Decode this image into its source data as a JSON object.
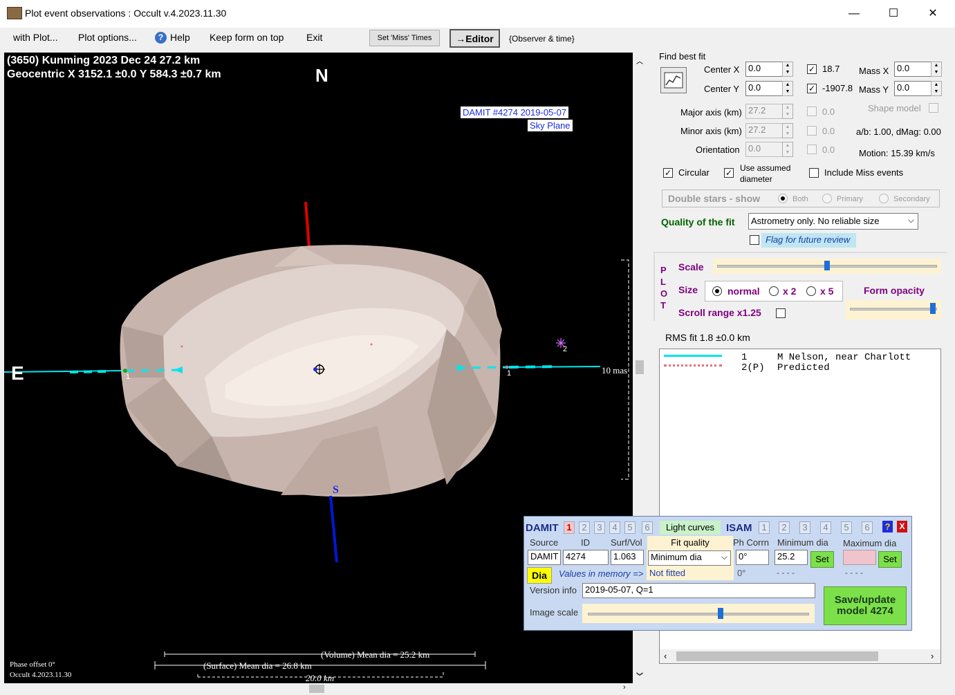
{
  "window": {
    "title": "Plot event observations : Occult v.4.2023.11.30",
    "minimize": "—",
    "maximize": "☐",
    "close": "✕"
  },
  "menu": {
    "items": [
      "with Plot...",
      "Plot options...",
      "Help",
      "Keep form on top",
      "Exit"
    ],
    "set_miss_times": "Set 'Miss' Times",
    "editor": "→Editor",
    "observer_time": "{Observer & time}"
  },
  "plot": {
    "header_line1": "(3650) Kunming  2023 Dec 24   27.2 km",
    "header_line2": "Geocentric  X  3152.1 ±0.0  Y 584.3 ±0.7 km",
    "north": "N",
    "east": "E",
    "south": "S",
    "damit_label": "DAMIT #4274 2019-05-07",
    "sky_plane": "Sky Plane",
    "chord_label_left": "1",
    "chord_label_right": "1",
    "star2_label": "2",
    "scale_mas": "10 mas",
    "volume_dia": "(Volume) Mean dia = 25.2 km",
    "surface_dia": "(Surface) Mean dia = 26.8 km",
    "scale_km": "20.0 km",
    "phase_offset": "Phase offset 0°",
    "occult_version": "Occult 4.2023.11.30"
  },
  "fit": {
    "find_best_fit": "Find best fit",
    "center_x_label": "Center X",
    "center_x": "0.0",
    "center_y_label": "Center Y",
    "center_y": "0.0",
    "center_x_value": "18.7",
    "center_y_value": "-1907.8",
    "mass_x_label": "Mass X",
    "mass_x": "0.0",
    "mass_y_label": "Mass Y",
    "mass_y": "0.0",
    "major_axis_label": "Major axis (km)",
    "major_axis": "27.2",
    "major_axis_value": "0.0",
    "minor_axis_label": "Minor axis (km)",
    "minor_axis": "27.2",
    "minor_axis_value": "0.0",
    "orientation_label": "Orientation",
    "orientation": "0.0",
    "orientation_value": "0.0",
    "shape_model": "Shape model",
    "ab_dmag": "a/b: 1.00, dMag: 0.00",
    "motion": "Motion: 15.39 km/s",
    "circular": "Circular",
    "use_assumed_diameter": "Use assumed diameter",
    "include_miss": "Include Miss events",
    "double_stars": "Double stars - show",
    "both": "Both",
    "primary": "Primary",
    "secondary": "Secondary",
    "quality_label": "Quality of the fit",
    "quality_value": "Astrometry only. No reliable size",
    "flag_review": "Flag for future review"
  },
  "plot_opts": {
    "plot_letters": [
      "P",
      "L",
      "O",
      "T"
    ],
    "scale": "Scale",
    "size": "Size",
    "normal": "normal",
    "x2": "x 2",
    "x5": "x 5",
    "form_opacity": "Form opacity",
    "scroll_range": "Scroll range x1.25",
    "scale_level": 0.5,
    "opacity_level": 0.95
  },
  "rms": {
    "label": "RMS fit  1.8 ±0.0 km",
    "legend": [
      {
        "num": "1",
        "name": "M Nelson, near Charlott",
        "color": "#00e5ee"
      },
      {
        "num": "2(P)",
        "name": "Predicted",
        "color": "#e0707a"
      }
    ]
  },
  "damit": {
    "title": "DAMIT",
    "tabs": [
      "1",
      "2",
      "3",
      "4",
      "5",
      "6"
    ],
    "light_curves": "Light curves",
    "isam": "ISAM",
    "isam_tabs": [
      "1",
      "2",
      "3",
      "4",
      "5",
      "6"
    ],
    "help": "?",
    "close": "X",
    "source_label": "Source",
    "id_label": "ID",
    "surfvol_label": "Surf/Vol",
    "fit_quality_label": "Fit quality",
    "ph_corrn_label": "Ph Corrn",
    "min_dia_label": "Minimum dia",
    "max_dia_label": "Maximum dia",
    "source": "DAMIT",
    "id": "4274",
    "surfvol": "1.063",
    "fit_quality": "Minimum dia",
    "ph_corrn": "0°",
    "min_dia": "25.2",
    "set": "Set",
    "dia": "Dia",
    "values_in_memory": "Values in memory =>",
    "not_fitted": "Not fitted",
    "mem_ph": "0°",
    "mem_min": "- - - -",
    "mem_max": "- - - -",
    "version_label": "Version info",
    "version": "2019-05-07, Q=1",
    "image_scale_label": "Image scale",
    "save_update": "Save/update model 4274",
    "image_scale_level": 0.6
  }
}
